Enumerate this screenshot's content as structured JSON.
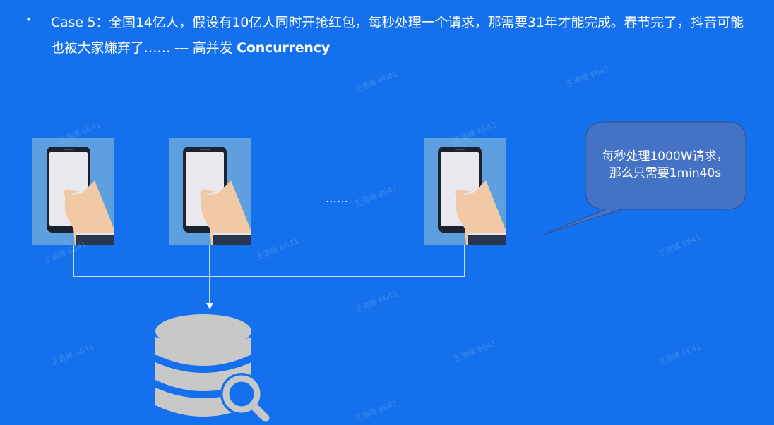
{
  "slide": {
    "bullet": "•",
    "text_plain": "Case 5：全国14亿人，假设有10亿人同时开抢红包，每秒处理一个请求，那需要31年才能完成。春节完了，抖音可能也被大家嫌弃了…… --- 高并发 ",
    "text_bold": "Concurrency",
    "ellipsis": "……",
    "callout_line1": "每秒处理1000W请求，",
    "callout_line2": "那么只需要1min40s",
    "watermark": "王清峰 6641"
  },
  "colors": {
    "background": "#1470ec",
    "callout_fill": "#4472c4",
    "callout_stroke": "#2f5597",
    "database_gray": "#c8c8c8",
    "phone_tile_bg": "#5e9fe0",
    "connector": "#ffffff"
  },
  "icons": {
    "phones": [
      "phone-in-hand-icon",
      "phone-in-hand-icon",
      "phone-in-hand-icon"
    ],
    "database": "database-search-icon"
  }
}
